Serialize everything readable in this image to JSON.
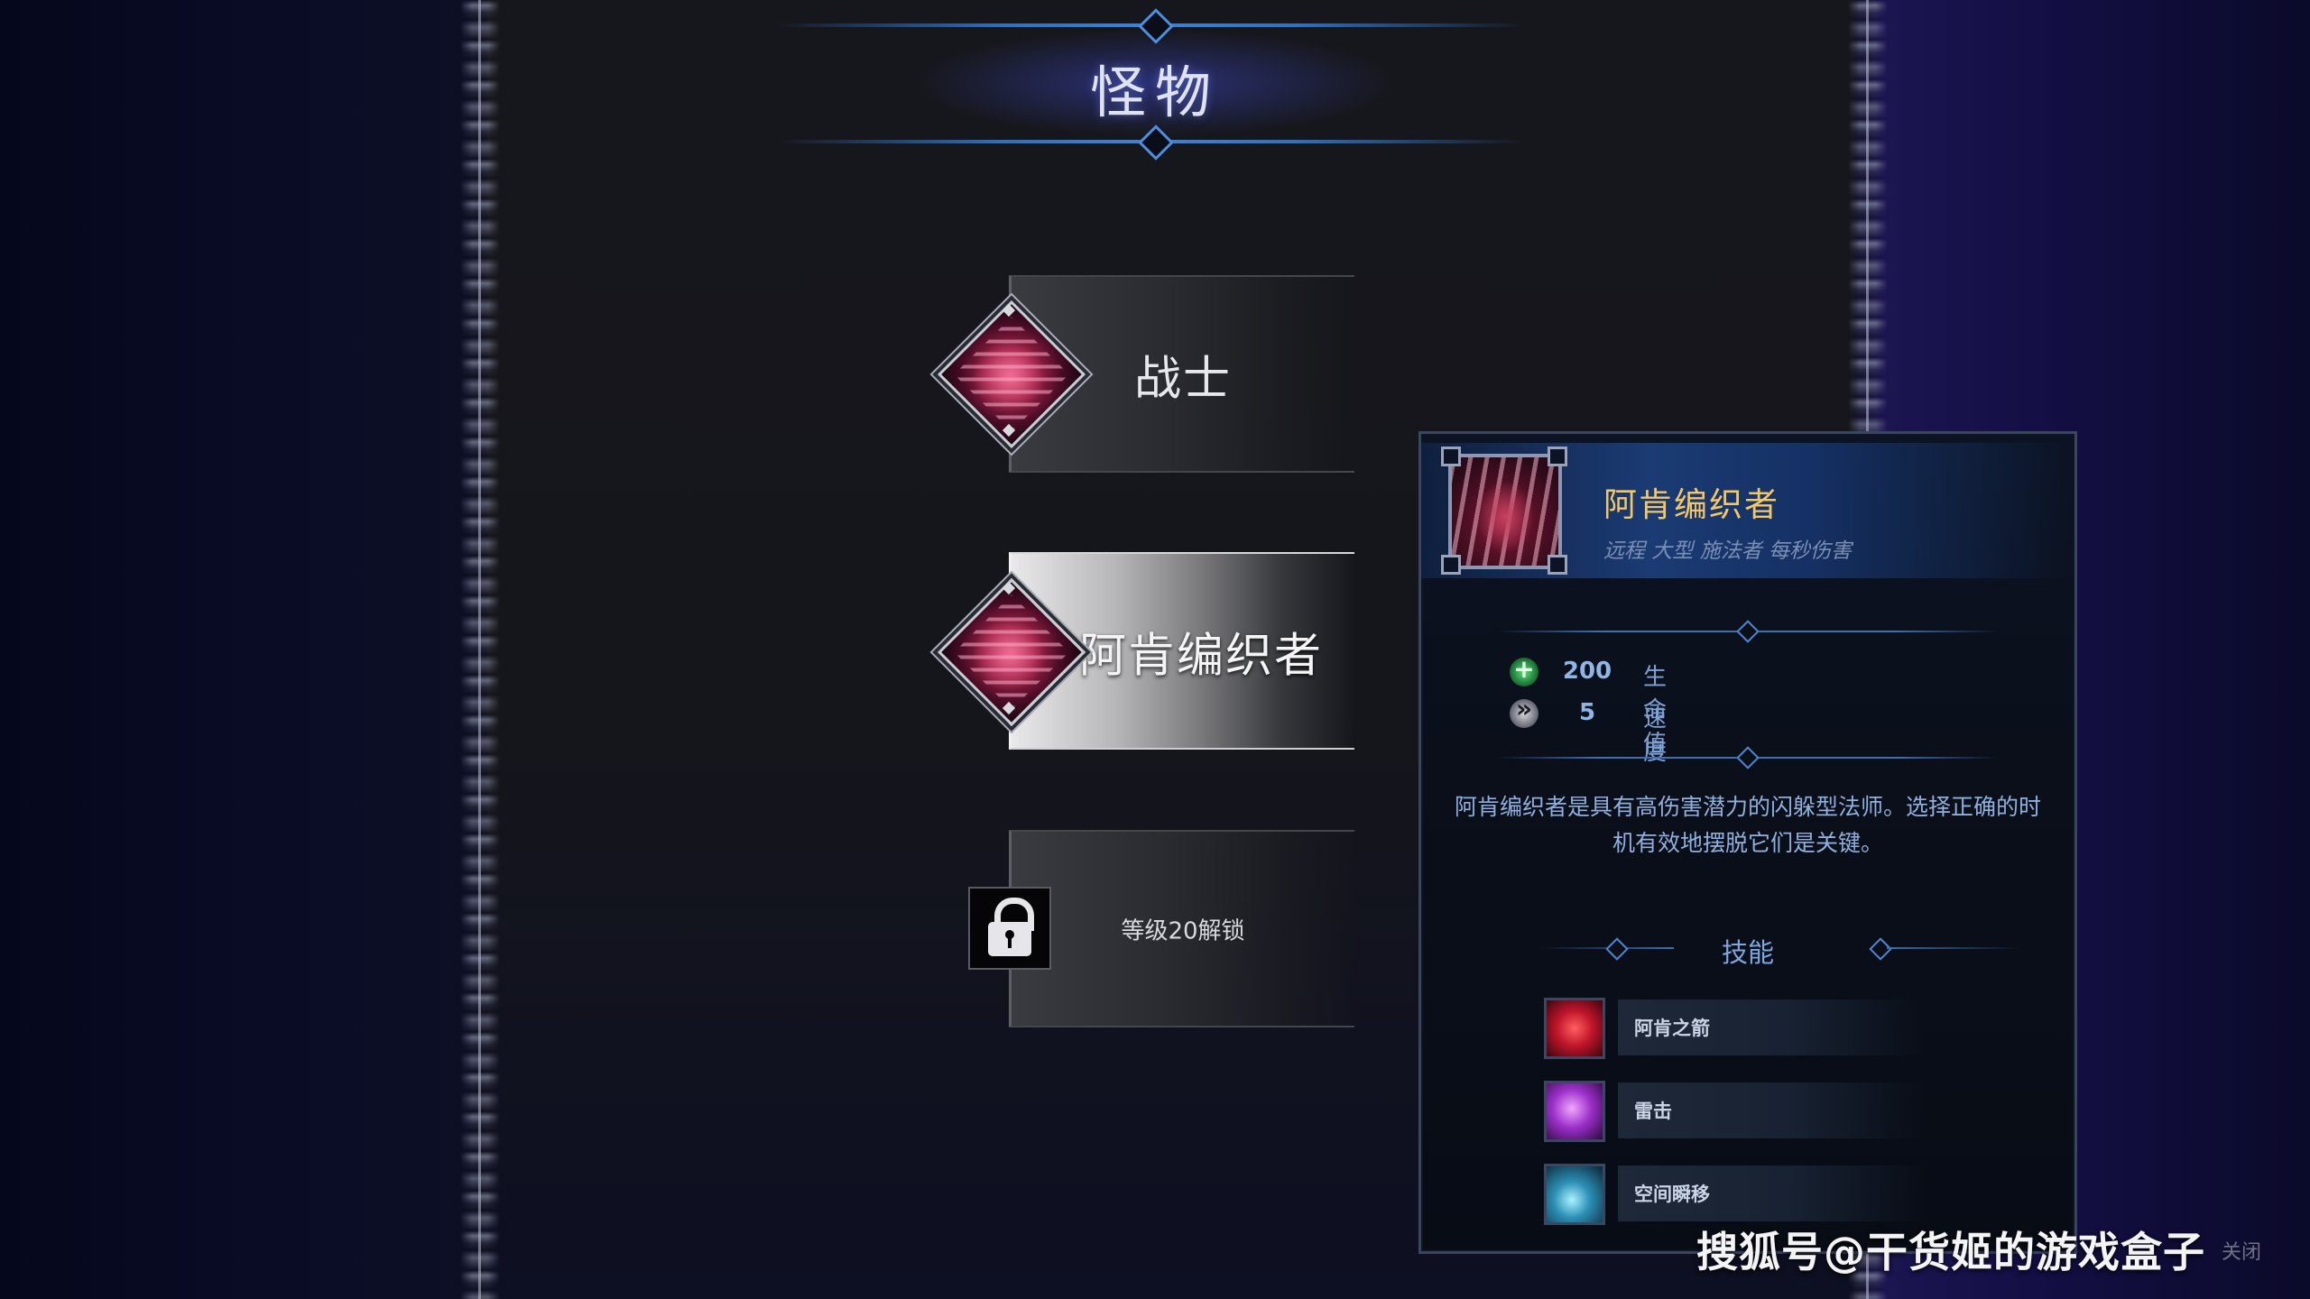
{
  "header": {
    "title": "怪物"
  },
  "monster_list": [
    {
      "name": "战士",
      "state": "normal"
    },
    {
      "name": "阿肯编织者",
      "state": "selected"
    },
    {
      "name": "等级20解锁",
      "state": "locked"
    }
  ],
  "tooltip": {
    "name": "阿肯编织者",
    "tags": "远程 大型 施法者 每秒伤害",
    "stats": [
      {
        "icon": "health-icon",
        "value": "200",
        "label": "生命值"
      },
      {
        "icon": "speed-icon",
        "value": "5",
        "label": "速度"
      }
    ],
    "description": "阿肯编织者是具有高伤害潜力的闪躲型法师。选择正确的时机有效地摆脱它们是关键。",
    "skills_title": "技能",
    "skills": [
      {
        "icon": "arcane-arrow-icon",
        "name": "阿肯之箭"
      },
      {
        "icon": "thunder-strike-icon",
        "name": "雷击"
      },
      {
        "icon": "spatial-blink-icon",
        "name": "空间瞬移"
      }
    ]
  },
  "footer": {
    "watermark": "搜狐号@干货姬的游戏盒子",
    "close_hint": "关闭"
  },
  "colors": {
    "title_accent": "#3d84d6",
    "name_gold": "#f2c766",
    "stat_blue": "#8fb4e6"
  }
}
